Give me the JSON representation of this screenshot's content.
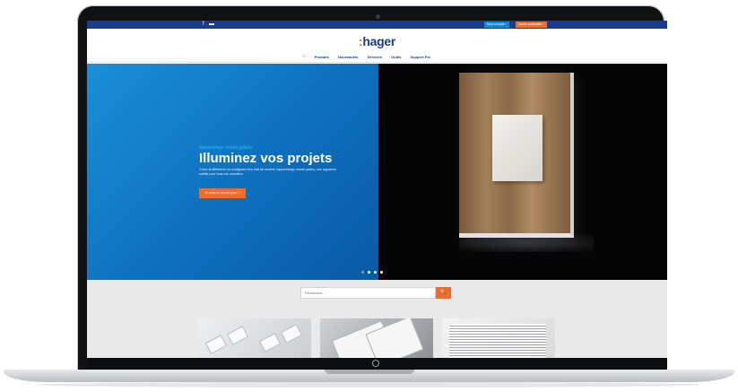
{
  "topbar": {
    "social": [
      "f",
      "▬"
    ],
    "account_label": "Mon compte  ›",
    "particulier_label": "Accès particulier  ›"
  },
  "header": {
    "logo_dots": ":",
    "logo_text": "hager",
    "home_icon": "⌂",
    "nav": [
      "Produits",
      "Nouveautés",
      "Services",
      "Outils",
      "Support Pro"
    ]
  },
  "hero": {
    "eyebrow": "Appareillage murali gallery",
    "title": "Illuminez vos projets",
    "description": "Créez la différence en soulignant d'un trait de lumière l'appareillage murali gallery, une signature subtile pour tous vos chantiers.",
    "cta_label": "Je veux en savoir plus !   ›",
    "slides": 4,
    "active_slide": 1
  },
  "search": {
    "placeholder": "Rechercher...",
    "button_icon": "🔍"
  },
  "colors": {
    "brand_blue": "#1b3c8c",
    "accent_orange": "#ec6d2e",
    "hero_blue": "#0d6fbd"
  }
}
